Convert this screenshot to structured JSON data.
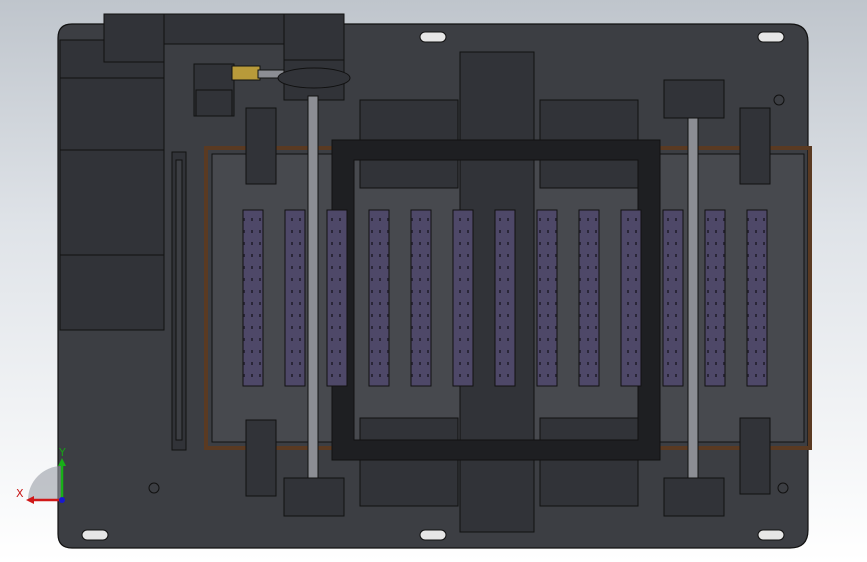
{
  "viewport": {
    "background_top": "#bfc5cc",
    "background_bottom": "#ffffff"
  },
  "triad": {
    "x_label": "X",
    "y_label": "Y",
    "x_color": "#d01818",
    "y_color": "#18b018",
    "z_color": "#1818d0"
  },
  "model": {
    "plate_color": "#3c3e43",
    "part_color": "#313338",
    "edge_color": "#111111",
    "inner_color": "#47494e",
    "belt_color": "#5a3a22",
    "roller_color": "#4e4868",
    "roller_count": 13,
    "gold_color": "#b89a3a",
    "shaft_color": "#8c8e94"
  }
}
